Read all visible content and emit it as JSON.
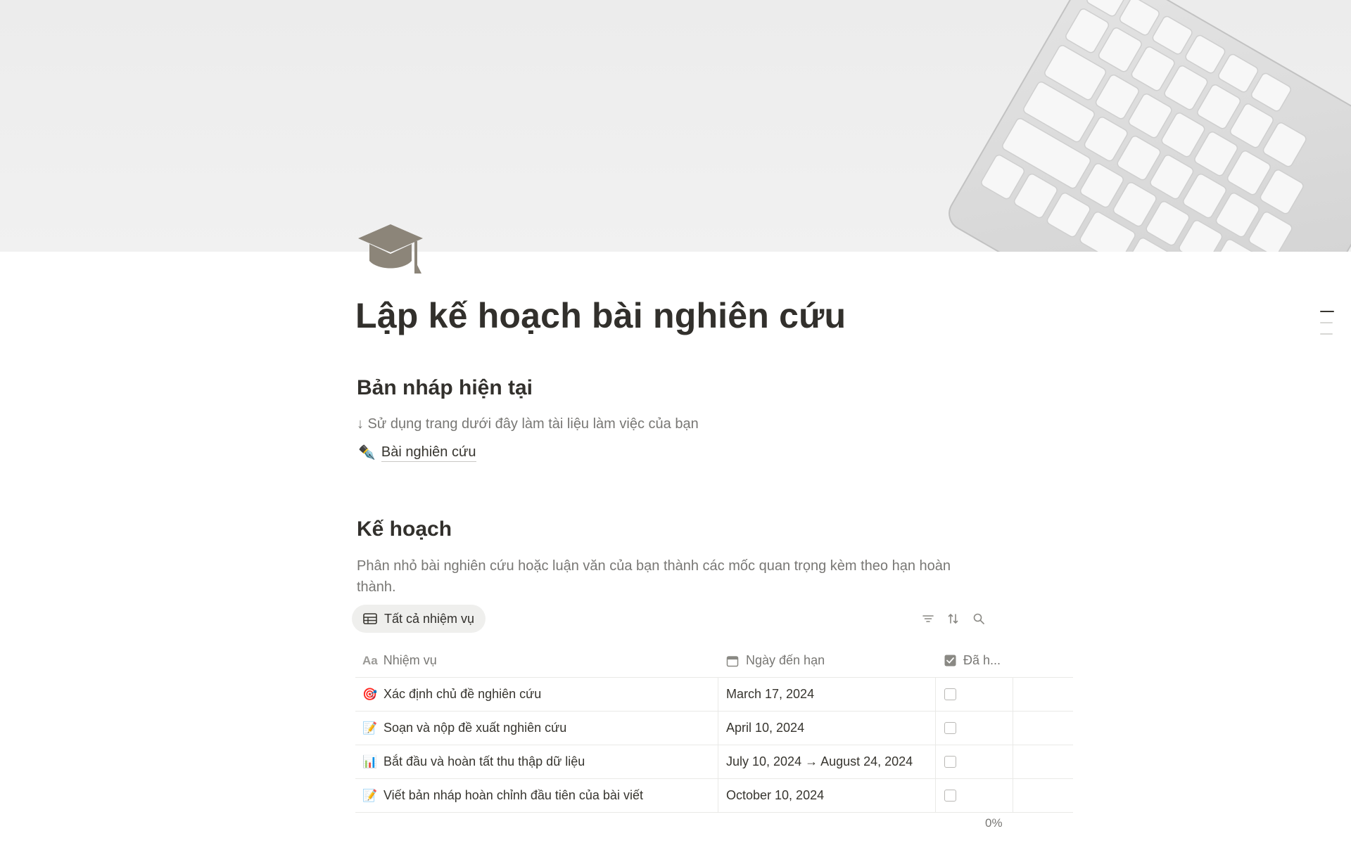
{
  "page": {
    "title": "Lập kế hoạch bài nghiên cứu",
    "icon": "graduation-cap-icon",
    "cover": "keyboard-on-white-desk-photo"
  },
  "sections": {
    "draft": {
      "heading": "Bản nháp hiện tại",
      "note": "↓ Sử dụng trang dưới đây làm tài liệu làm việc của bạn",
      "link": {
        "emoji": "✒️",
        "label": "Bài nghiên cứu"
      }
    },
    "plan": {
      "heading": "Kế hoạch",
      "description": "Phân nhỏ bài nghiên cứu hoặc luận văn của bạn thành các mốc quan trọng kèm theo hạn hoàn thành."
    }
  },
  "database": {
    "view_label": "Tất cả nhiệm vụ",
    "tools": [
      "filter-icon",
      "sort-icon",
      "search-icon"
    ],
    "columns": [
      {
        "icon": "Aa",
        "label": "Nhiệm vụ"
      },
      {
        "icon": "calendar-icon",
        "label": "Ngày đến hạn"
      },
      {
        "icon": "checkbox-icon",
        "label": "Đã h..."
      }
    ],
    "rows": [
      {
        "emoji": "🎯",
        "task": "Xác định chủ đề nghiên cứu",
        "due": "March 17, 2024",
        "done": false
      },
      {
        "emoji": "📝",
        "task": "Soạn và nộp đề xuất nghiên cứu",
        "due": "April 10, 2024",
        "done": false
      },
      {
        "emoji": "📊",
        "task": "Bắt đầu và hoàn tất thu thập dữ liệu",
        "due": "July 10, 2024 → August 24, 2024",
        "done": false
      },
      {
        "emoji": "📝",
        "task": "Viết bản nháp hoàn chỉnh đầu tiên của bài viết",
        "due": "October 10, 2024",
        "done": false
      }
    ],
    "calculation": "0%"
  },
  "colors": {
    "text": "#37352f",
    "muted": "#787774",
    "border": "#e9e9e7",
    "tab_bg": "#efefed"
  }
}
